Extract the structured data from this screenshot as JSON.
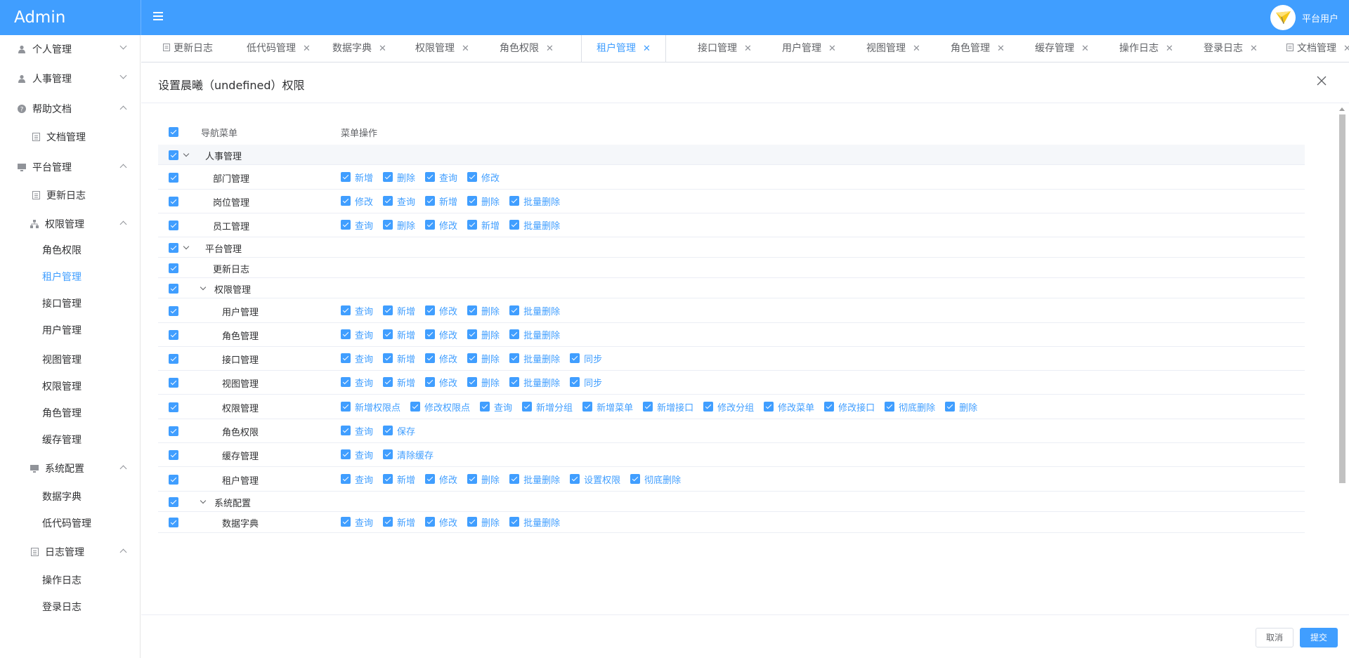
{
  "app": {
    "title": "Admin",
    "user_name": "平台用户"
  },
  "colors": {
    "primary": "#409eff",
    "sidebar_bg": "#ffffff",
    "text": "#303133"
  },
  "sidebar": {
    "items": [
      {
        "label": "个人管理",
        "icon": "user-icon",
        "arrow": "down"
      },
      {
        "label": "人事管理",
        "icon": "user-icon",
        "arrow": "down"
      },
      {
        "label": "帮助文档",
        "icon": "question-icon",
        "arrow": "up"
      },
      {
        "label": "文档管理",
        "icon": "document-icon"
      },
      {
        "label": "平台管理",
        "icon": "monitor-icon",
        "arrow": "up"
      },
      {
        "label": "更新日志",
        "icon": "document-icon"
      },
      {
        "label": "权限管理",
        "icon": "org-tree-icon",
        "arrow": "up"
      },
      {
        "label": "角色权限"
      },
      {
        "label": "租户管理",
        "active": true
      },
      {
        "label": "接口管理"
      },
      {
        "label": "用户管理"
      },
      {
        "label": "视图管理"
      },
      {
        "label": "权限管理"
      },
      {
        "label": "角色管理"
      },
      {
        "label": "缓存管理"
      },
      {
        "label": "系统配置",
        "icon": "monitor-icon",
        "arrow": "up"
      },
      {
        "label": "数据字典"
      },
      {
        "label": "低代码管理"
      },
      {
        "label": "日志管理",
        "icon": "document-icon",
        "arrow": "up"
      },
      {
        "label": "操作日志"
      },
      {
        "label": "登录日志"
      }
    ]
  },
  "tabs": [
    {
      "label": "更新日志",
      "icon": "document-icon",
      "closable": false
    },
    {
      "label": "低代码管理",
      "closable": true
    },
    {
      "label": "数据字典",
      "closable": true
    },
    {
      "label": "权限管理",
      "closable": true
    },
    {
      "label": "角色权限",
      "closable": true
    },
    {
      "label": "租户管理",
      "closable": true,
      "active": true
    },
    {
      "label": "接口管理",
      "closable": true
    },
    {
      "label": "用户管理",
      "closable": true
    },
    {
      "label": "视图管理",
      "closable": true
    },
    {
      "label": "角色管理",
      "closable": true
    },
    {
      "label": "缓存管理",
      "closable": true
    },
    {
      "label": "操作日志",
      "closable": true
    },
    {
      "label": "登录日志",
      "closable": true
    },
    {
      "label": "文档管理",
      "icon": "document-icon",
      "closable": true
    }
  ],
  "dialog": {
    "title": "设置晨曦（undefined）权限",
    "columns": {
      "nav": "导航菜单",
      "ops": "菜单操作"
    },
    "rows": [
      {
        "label": "人事管理",
        "level": 0,
        "group": true,
        "expandable": true,
        "ops": []
      },
      {
        "label": "部门管理",
        "level": 1,
        "ops": [
          "新增",
          "删除",
          "查询",
          "修改"
        ]
      },
      {
        "label": "岗位管理",
        "level": 1,
        "ops": [
          "修改",
          "查询",
          "新增",
          "删除",
          "批量删除"
        ]
      },
      {
        "label": "员工管理",
        "level": 1,
        "ops": [
          "查询",
          "删除",
          "修改",
          "新增",
          "批量删除"
        ]
      },
      {
        "label": "平台管理",
        "level": 0,
        "expandable": true,
        "ops": []
      },
      {
        "label": "更新日志",
        "level": 1,
        "ops": []
      },
      {
        "label": "权限管理",
        "level": 1,
        "expandable": true,
        "ops": []
      },
      {
        "label": "用户管理",
        "level": 2,
        "ops": [
          "查询",
          "新增",
          "修改",
          "删除",
          "批量删除"
        ]
      },
      {
        "label": "角色管理",
        "level": 2,
        "ops": [
          "查询",
          "新增",
          "修改",
          "删除",
          "批量删除"
        ]
      },
      {
        "label": "接口管理",
        "level": 2,
        "ops": [
          "查询",
          "新增",
          "修改",
          "删除",
          "批量删除",
          "同步"
        ]
      },
      {
        "label": "视图管理",
        "level": 2,
        "ops": [
          "查询",
          "新增",
          "修改",
          "删除",
          "批量删除",
          "同步"
        ]
      },
      {
        "label": "权限管理",
        "level": 2,
        "ops": [
          "新增权限点",
          "修改权限点",
          "查询",
          "新增分组",
          "新增菜单",
          "新增接口",
          "修改分组",
          "修改菜单",
          "修改接口",
          "彻底删除",
          "删除"
        ]
      },
      {
        "label": "角色权限",
        "level": 2,
        "ops": [
          "查询",
          "保存"
        ]
      },
      {
        "label": "缓存管理",
        "level": 2,
        "ops": [
          "查询",
          "清除缓存"
        ]
      },
      {
        "label": "租户管理",
        "level": 2,
        "ops": [
          "查询",
          "新增",
          "修改",
          "删除",
          "批量删除",
          "设置权限",
          "彻底删除"
        ]
      },
      {
        "label": "系统配置",
        "level": 1,
        "expandable": true,
        "ops": []
      },
      {
        "label": "数据字典",
        "level": 2,
        "ops": [
          "查询",
          "新增",
          "修改",
          "删除",
          "批量删除"
        ]
      }
    ],
    "footer": {
      "cancel": "取消",
      "submit": "提交"
    }
  }
}
